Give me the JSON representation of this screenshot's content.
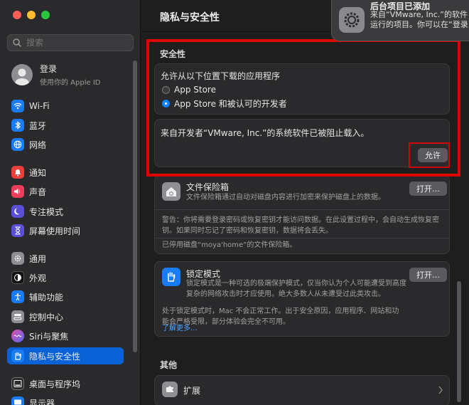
{
  "window": {
    "title": "隐私与安全性"
  },
  "sidebar": {
    "search_placeholder": "搜索",
    "login": {
      "title": "登录",
      "subtitle": "使用你的 Apple ID"
    },
    "items": [
      {
        "label": "Wi-Fi",
        "icon": "wifi-icon",
        "color": "#1a7cf5"
      },
      {
        "label": "蓝牙",
        "icon": "bluetooth-icon",
        "color": "#1a7cf5"
      },
      {
        "label": "网络",
        "icon": "globe-icon",
        "color": "#1a7cf5"
      },
      {
        "label": "通知",
        "icon": "bell-icon",
        "color": "#ea3f3a"
      },
      {
        "label": "声音",
        "icon": "speaker-icon",
        "color": "#ea3f5a"
      },
      {
        "label": "专注模式",
        "icon": "moon-icon",
        "color": "#5a4fd6"
      },
      {
        "label": "屏幕使用时间",
        "icon": "hourglass-icon",
        "color": "#5a4fd6"
      },
      {
        "label": "通用",
        "icon": "gear-icon",
        "color": "#8e8e93"
      },
      {
        "label": "外观",
        "icon": "appearance-icon",
        "color": "#111111"
      },
      {
        "label": "辅助功能",
        "icon": "accessibility-icon",
        "color": "#1a7cf5"
      },
      {
        "label": "控制中心",
        "icon": "control-center-icon",
        "color": "#8e8e93"
      },
      {
        "label": "Siri与聚焦",
        "icon": "siri-icon",
        "color": "#b44ad8"
      },
      {
        "label": "隐私与安全性",
        "icon": "hand-icon",
        "color": "#1a7cf5"
      },
      {
        "label": "桌面与程序坞",
        "icon": "dock-icon",
        "color": "#2a2a2c"
      },
      {
        "label": "显示器",
        "icon": "display-icon",
        "color": "#1a7cf5"
      }
    ]
  },
  "security": {
    "section_title": "安全性",
    "download_title": "允许从以下位置下载的应用程序",
    "options": [
      "App Store",
      "App Store 和被认可的开发者"
    ],
    "blocked_message": "来自开发者“VMware, Inc.”的系统软件已被阻止载入。",
    "allow_button": "允许"
  },
  "filevault": {
    "title": "文件保险箱",
    "desc": "文件保险箱通过自动对磁盘内容进行加密来保护磁盘上的数据。",
    "button": "打开…",
    "warning": "警告：你将需要登录密码或恢复密钥才能访问数据。在此设置过程中，会自动生成恢复密钥。如果同时忘记了密码和恢复密钥，数据将会丢失。",
    "disabled_note": "已停用磁盘“moya'home”的文件保险箱。"
  },
  "lockdown": {
    "title": "锁定模式",
    "desc": "锁定模式是一种可选的极端保护模式，仅当你认为个人可能遭受到高度复杂的网络攻击时才应使用。绝大多数人从未遭受过此类攻击。",
    "button": "打开…",
    "note": "处于锁定模式时，Mac 不会正常工作。出于安全原因，应用程序、网站和功能会严格受限，部分体验会完全不可用。",
    "learn_more": "了解更多…"
  },
  "others": {
    "section_title": "其他",
    "extensions": "扩展"
  },
  "notification": {
    "title": "后台项目已添加",
    "body": "来自“VMware, Inc.”的软件运行的项目。你可以在“登录"
  }
}
